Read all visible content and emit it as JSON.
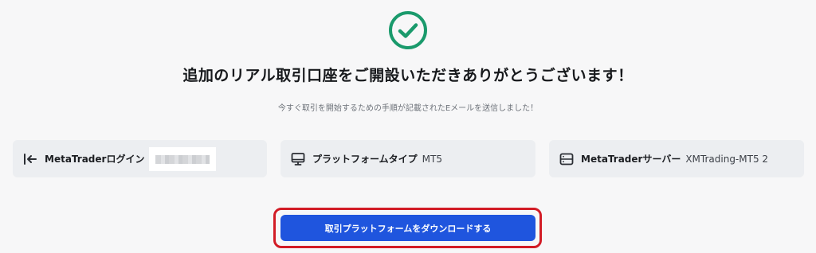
{
  "success": {
    "icon": "check-circle-icon",
    "color": "#1a9a6c"
  },
  "title": "追加のリアル取引口座をご開設いただきありがとうございます！",
  "subtitle": "今すぐ取引を開始するための手順が記載されたEメールを送信しました！",
  "cards": [
    {
      "icon": "login-arrow-icon",
      "label": "MetaTraderログイン",
      "value": "",
      "value_masked": true
    },
    {
      "icon": "monitor-icon",
      "label": "プラットフォームタイプ",
      "value": "MT5"
    },
    {
      "icon": "server-icon",
      "label": "MetaTraderサーバー",
      "value": "XMTrading-MT5 2"
    }
  ],
  "cta": {
    "label": "取引プラットフォームをダウンロードする",
    "color": "#1f55de",
    "highlight_color": "#d21c26"
  }
}
